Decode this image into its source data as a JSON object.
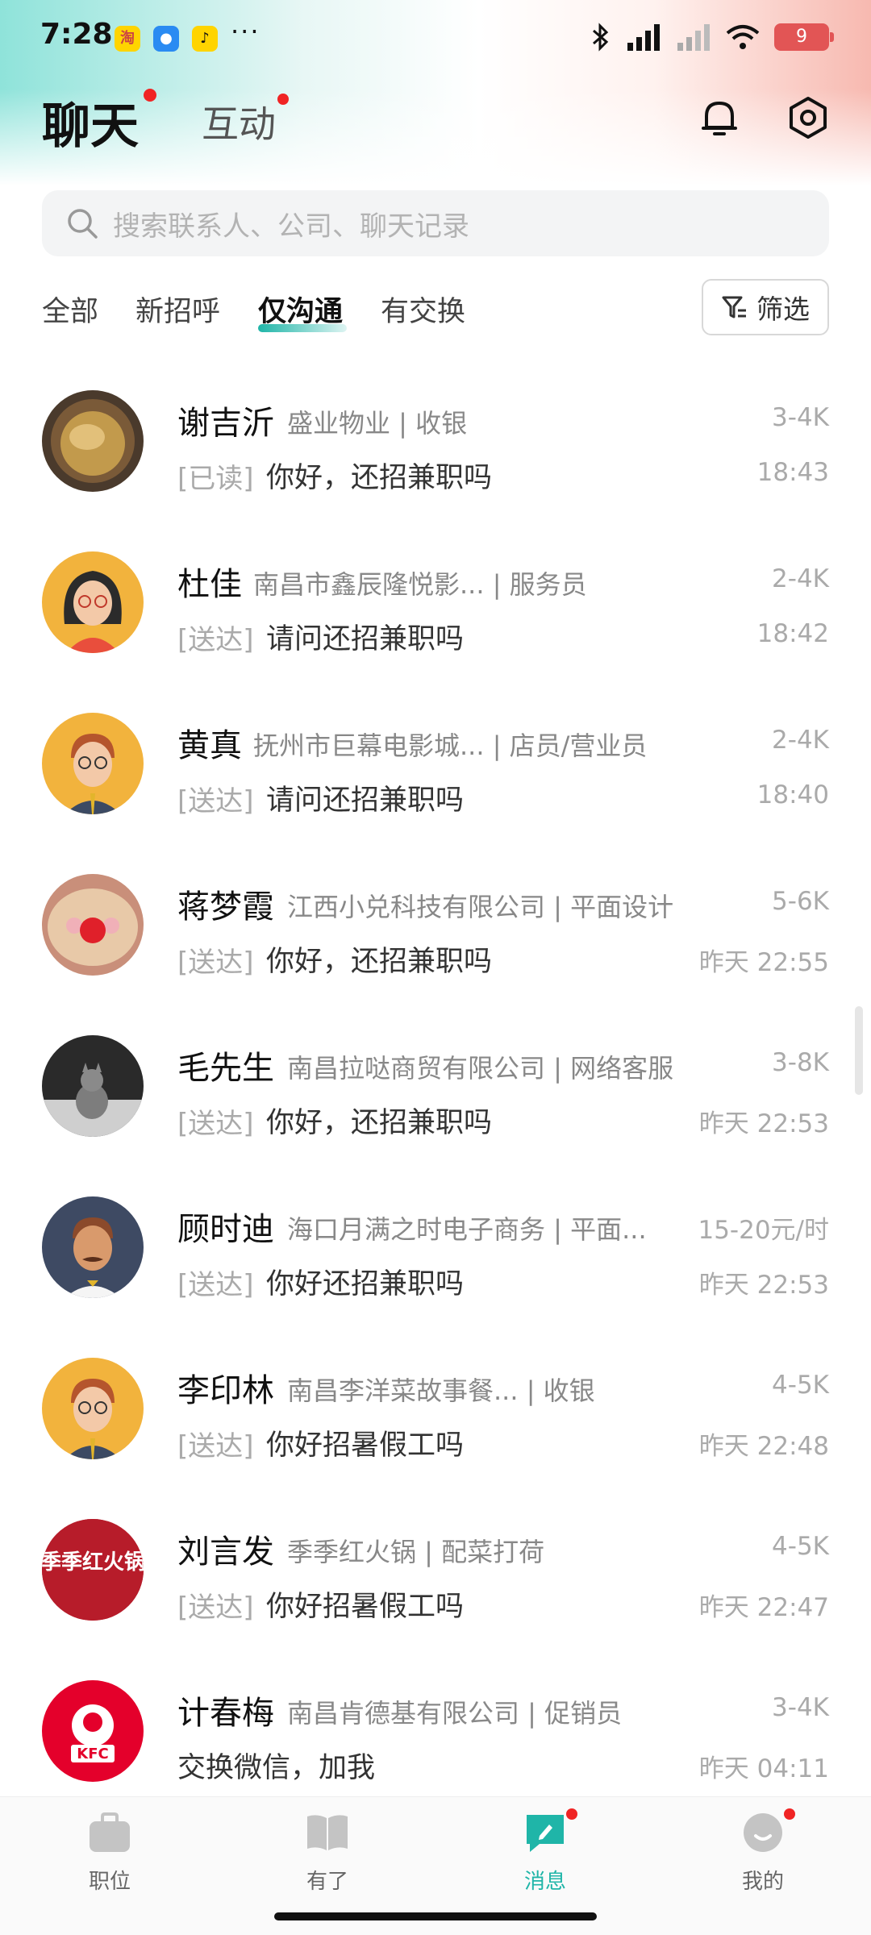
{
  "status_bar": {
    "time": "7:28",
    "app_icons": [
      "taobao",
      "chat-app",
      "music-app"
    ],
    "more": "···",
    "battery": "9"
  },
  "header": {
    "title": "聊天",
    "secondary_tab": "互动",
    "icons": [
      "bell-icon",
      "settings-icon"
    ]
  },
  "search": {
    "placeholder": "搜索联系人、公司、聊天记录"
  },
  "tabs": {
    "items": [
      "全部",
      "新招呼",
      "仅沟通",
      "有交换"
    ],
    "active": "仅沟通",
    "filter_label": "筛选"
  },
  "chats": [
    {
      "name": "谢吉沂",
      "company": "盛业物业 | 收银",
      "salary": "3-4K",
      "status": "[已读]",
      "message": "你好，还招兼职吗",
      "time": "18:43"
    },
    {
      "name": "杜佳",
      "company": "南昌市鑫辰隆悦影... | 服务员",
      "salary": "2-4K",
      "status": "[送达]",
      "message": "请问还招兼职吗",
      "time": "18:42"
    },
    {
      "name": "黄真",
      "company": "抚州市巨幕电影城... | 店员/营业员",
      "salary": "2-4K",
      "status": "[送达]",
      "message": "请问还招兼职吗",
      "time": "18:40"
    },
    {
      "name": "蒋梦霞",
      "company": "江西小兑科技有限公司 | 平面设计",
      "salary": "5-6K",
      "status": "[送达]",
      "message": "你好，还招兼职吗",
      "time": "昨天 22:55"
    },
    {
      "name": "毛先生",
      "company": "南昌拉哒商贸有限公司 | 网络客服",
      "salary": "3-8K",
      "status": "[送达]",
      "message": "你好，还招兼职吗",
      "time": "昨天 22:53"
    },
    {
      "name": "顾时迪",
      "company": "海口月满之时电子商务 | 平面...",
      "salary": "15-20元/时",
      "status": "[送达]",
      "message": "你好还招兼职吗",
      "time": "昨天 22:53"
    },
    {
      "name": "李印林",
      "company": "南昌李洋菜故事餐... | 收银",
      "salary": "4-5K",
      "status": "[送达]",
      "message": "你好招暑假工吗",
      "time": "昨天 22:48"
    },
    {
      "name": "刘言发",
      "company": "季季红火锅 | 配菜打荷",
      "salary": "4-5K",
      "status": "[送达]",
      "message": "你好招暑假工吗",
      "time": "昨天 22:47",
      "avatar_text": "季季红火锅"
    },
    {
      "name": "计春梅",
      "company": "南昌肯德基有限公司 | 促销员",
      "salary": "3-4K",
      "status": "",
      "message": "交换微信，加我",
      "time": "昨天 04:11",
      "avatar_text": "KFC"
    }
  ],
  "bottom_nav": {
    "items": [
      "职位",
      "有了",
      "消息",
      "我的"
    ],
    "active": "消息"
  },
  "colors": {
    "accent": "#1fb5a8",
    "badge": "#f02424"
  }
}
